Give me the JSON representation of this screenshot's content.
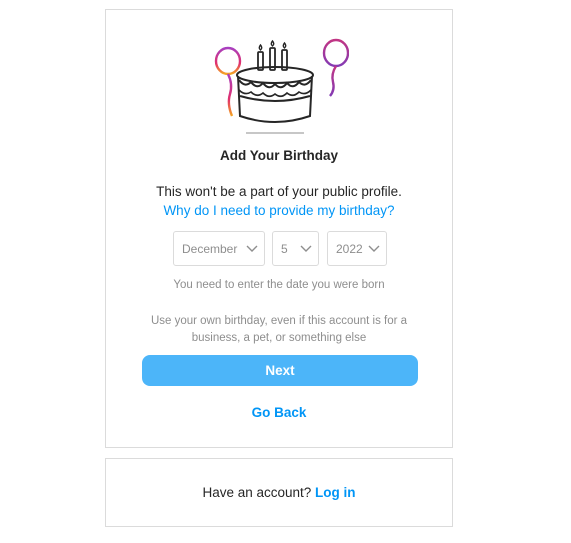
{
  "title": "Add Your Birthday",
  "subtitle": "This won't be a part of your public profile.",
  "why_link": "Why do I need to provide my birthday?",
  "month": {
    "value": "December"
  },
  "day": {
    "value": "5"
  },
  "year": {
    "value": "2022"
  },
  "hint": "You need to enter the date you were born",
  "note": "Use your own birthday, even if this account is for a business, a pet, or something else",
  "next_label": "Next",
  "back_label": "Go Back",
  "login": {
    "prompt": "Have an account?",
    "link": "Log in"
  },
  "colors": {
    "accent": "#0095f6",
    "button": "#4cb5f9",
    "border": "#dbdbdb",
    "muted": "#8e8e8e",
    "text": "#262626"
  },
  "icons": {
    "illustration": "birthday-cake-with-balloons",
    "dropdown": "chevron-down-icon"
  }
}
